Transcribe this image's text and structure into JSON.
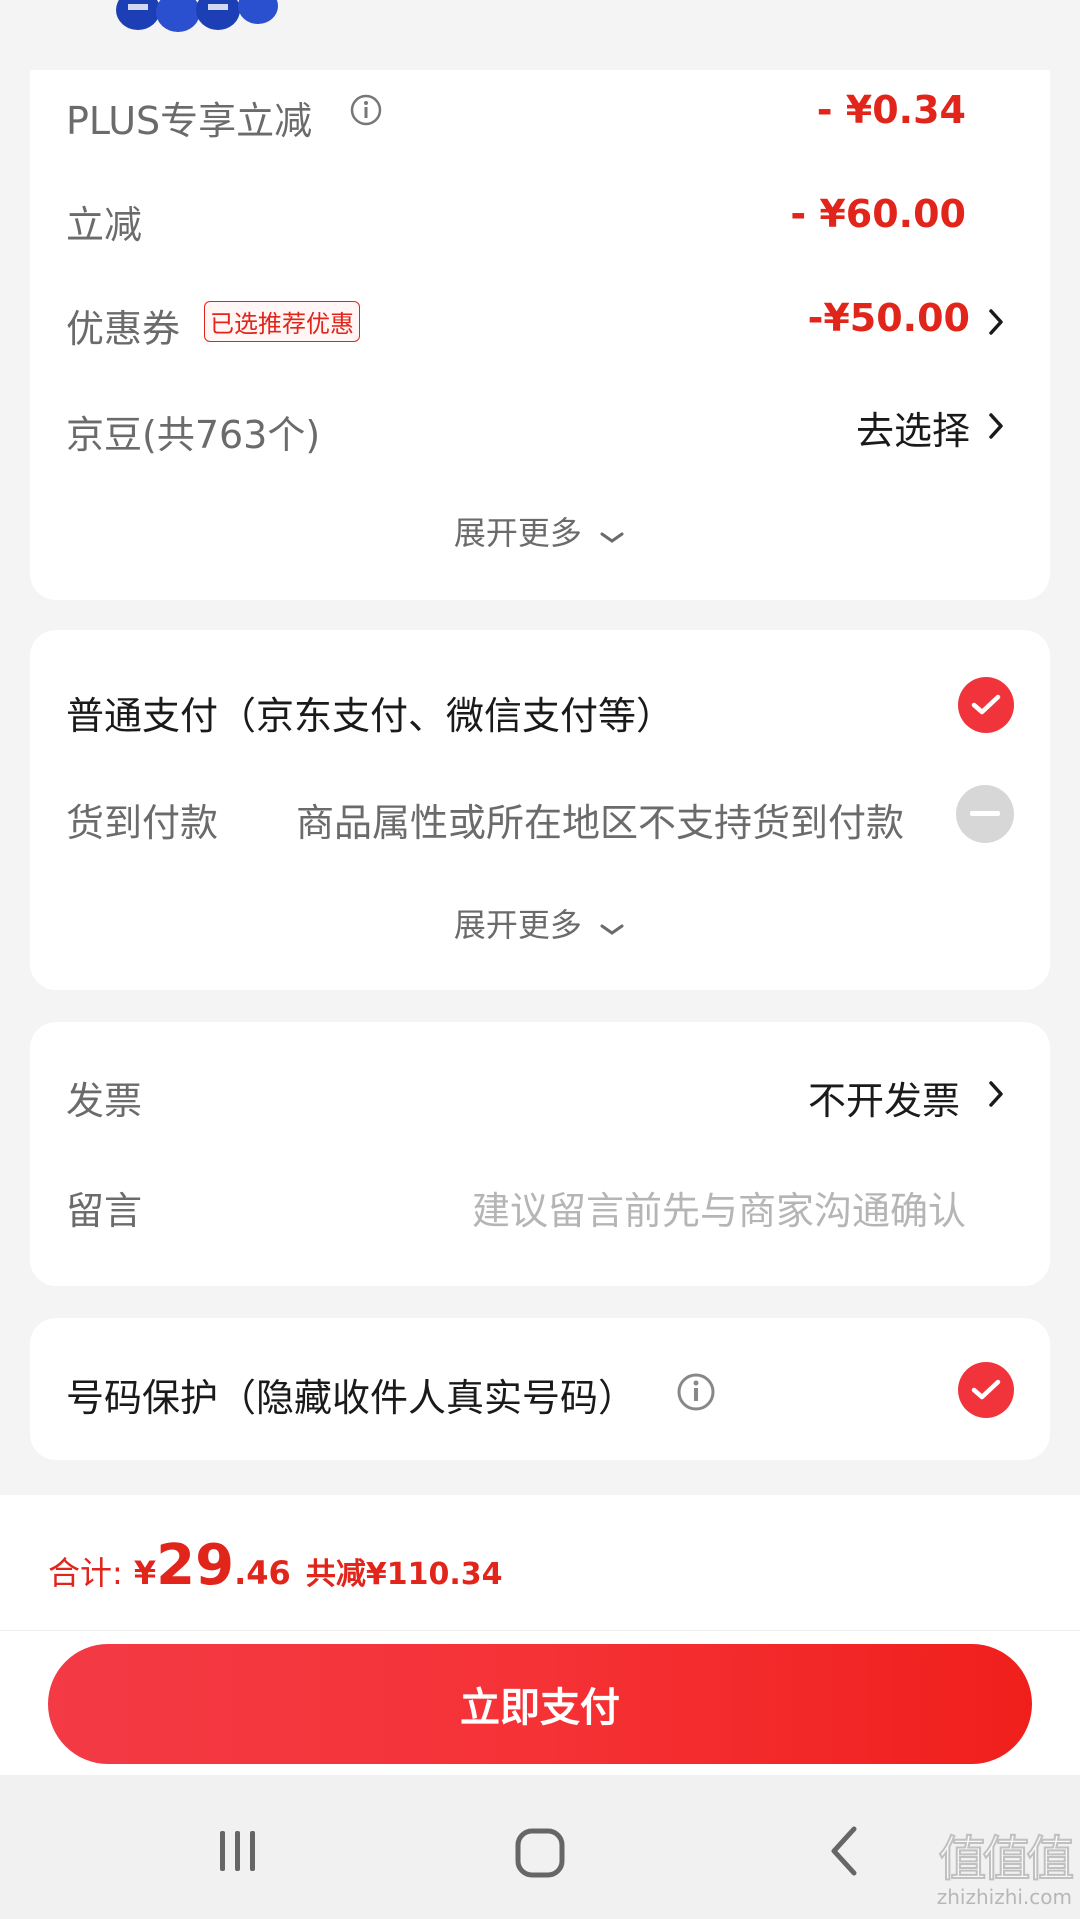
{
  "discounts": {
    "plus_label": "PLUS专享立减",
    "plus_amount": "- ¥0.34",
    "direct_label": "立减",
    "direct_amount": "- ¥60.00",
    "coupon_label": "优惠券",
    "coupon_tag": "已选推荐优惠",
    "coupon_amount": "-¥50.00",
    "beans_label": "京豆(共763个)",
    "beans_action": "去选择",
    "expand_more": "展开更多"
  },
  "payment": {
    "normal_label": "普通支付（京东支付、微信支付等）",
    "cod_label": "货到付款",
    "cod_note": "商品属性或所在地区不支持货到付款",
    "expand_more": "展开更多"
  },
  "invoice": {
    "invoice_label": "发票",
    "invoice_value": "不开发票",
    "message_label": "留言",
    "message_placeholder": "建议留言前先与商家沟通确认"
  },
  "privacy": {
    "label": "号码保护（隐藏收件人真实号码）"
  },
  "total": {
    "label": "合计:",
    "currency": "¥",
    "integer": "29",
    "decimal": ".46",
    "saved": "共减¥110.34"
  },
  "pay_button": "立即支付",
  "watermark": {
    "logo": "值值值",
    "url": "zhizhizhi.com"
  },
  "colors": {
    "accent_red": "#e1251b",
    "button_red": "#f33a45",
    "disabled_gray": "#d7d7d7"
  },
  "icons": [
    "info-icon",
    "chevron-right-icon",
    "chevron-down-icon",
    "check-icon",
    "minus-icon",
    "recents-icon",
    "home-icon",
    "back-icon"
  ]
}
